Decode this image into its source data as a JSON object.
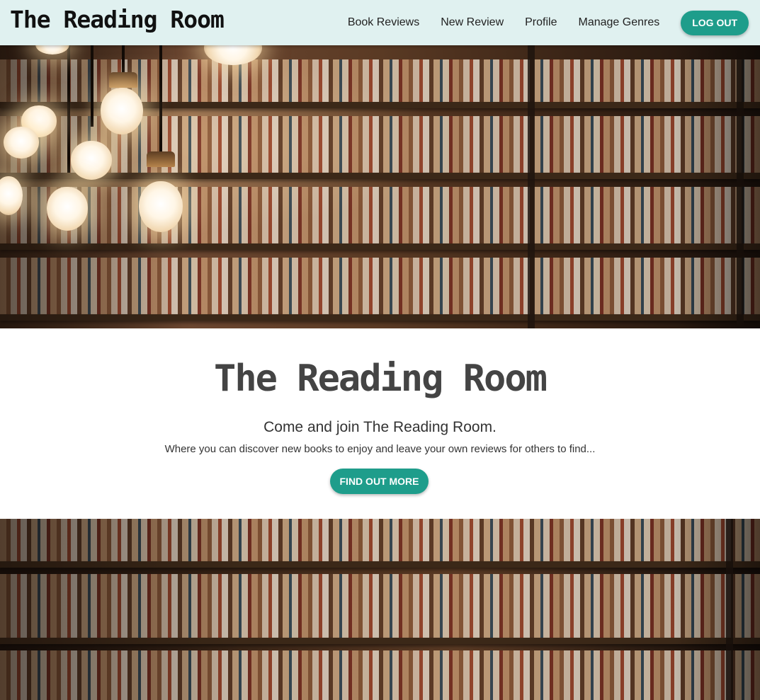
{
  "navbar": {
    "brand": "The Reading Room",
    "links": [
      "Book Reviews",
      "New Review",
      "Profile",
      "Manage Genres"
    ],
    "logout_label": "Log Out"
  },
  "hero_top": {
    "icon": "library-bookshelves-with-hanging-bulbs-image"
  },
  "welcome": {
    "title": "The Reading Room",
    "subtitle": "Come and join The Reading Room.",
    "text": "Where you can discover new books to enjoy and leave your own reviews for others to find...",
    "button_label": "Find Out More"
  },
  "hero_bottom": {
    "icon": "library-bookshelves-image"
  },
  "colors": {
    "navbar_bg": "#e0f1f0",
    "accent": "#1e9d8b",
    "title_text": "#444444",
    "body_text": "#333333"
  }
}
